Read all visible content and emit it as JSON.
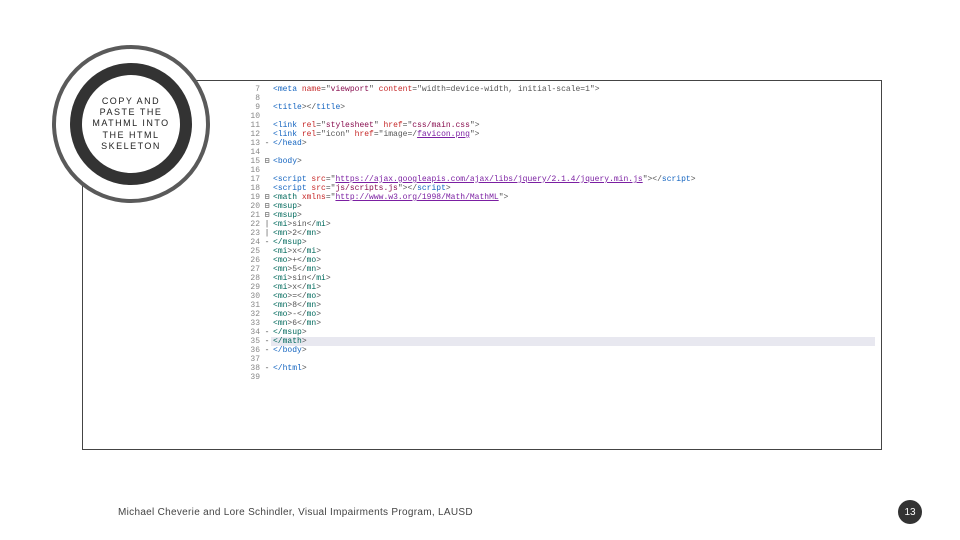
{
  "badge": {
    "title": "COPY AND PASTE THE MATHML INTO THE HTML SKELETON"
  },
  "code": {
    "lines": [
      {
        "n": 7,
        "fold": "",
        "hl": false,
        "segs": [
          {
            "t": "    <",
            "c": "s-blue"
          },
          {
            "t": "meta ",
            "c": "s-blue"
          },
          {
            "t": "name",
            "c": "s-red"
          },
          {
            "t": "=\"",
            "c": ""
          },
          {
            "t": "viewport",
            "c": "s-maroon"
          },
          {
            "t": "\" ",
            "c": ""
          },
          {
            "t": "content",
            "c": "s-red"
          },
          {
            "t": "=\"width=device-width, initial-scale=1\">",
            "c": ""
          }
        ]
      },
      {
        "n": 8,
        "fold": "",
        "hl": false,
        "segs": [
          {
            "t": "",
            "c": ""
          }
        ]
      },
      {
        "n": 9,
        "fold": "",
        "hl": false,
        "segs": [
          {
            "t": "    <",
            "c": "s-blue"
          },
          {
            "t": "title",
            "c": "s-blue"
          },
          {
            "t": "></",
            "c": ""
          },
          {
            "t": "title",
            "c": "s-blue"
          },
          {
            "t": ">",
            "c": ""
          }
        ]
      },
      {
        "n": 10,
        "fold": "",
        "hl": false,
        "segs": [
          {
            "t": "",
            "c": ""
          }
        ]
      },
      {
        "n": 11,
        "fold": "",
        "hl": false,
        "segs": [
          {
            "t": "    <",
            "c": "s-blue"
          },
          {
            "t": "link ",
            "c": "s-blue"
          },
          {
            "t": "rel",
            "c": "s-red"
          },
          {
            "t": "=\"",
            "c": ""
          },
          {
            "t": "stylesheet",
            "c": "s-maroon"
          },
          {
            "t": "\" ",
            "c": ""
          },
          {
            "t": "href",
            "c": "s-red"
          },
          {
            "t": "=\"",
            "c": ""
          },
          {
            "t": "css/main.css",
            "c": "s-maroon"
          },
          {
            "t": "\">",
            "c": ""
          }
        ]
      },
      {
        "n": 12,
        "fold": "",
        "hl": false,
        "segs": [
          {
            "t": "    <",
            "c": "s-blue"
          },
          {
            "t": "link ",
            "c": "s-blue"
          },
          {
            "t": "rel",
            "c": "s-red"
          },
          {
            "t": "=\"icon\" ",
            "c": ""
          },
          {
            "t": "href",
            "c": "s-red"
          },
          {
            "t": "=\"image=/",
            "c": ""
          },
          {
            "t": "favicon.png",
            "c": "s-purple"
          },
          {
            "t": "\">",
            "c": ""
          }
        ]
      },
      {
        "n": 13,
        "fold": "-",
        "hl": false,
        "segs": [
          {
            "t": "</",
            "c": "s-blue"
          },
          {
            "t": "head",
            "c": "s-blue"
          },
          {
            "t": ">",
            "c": ""
          }
        ]
      },
      {
        "n": 14,
        "fold": "",
        "hl": false,
        "segs": [
          {
            "t": "",
            "c": ""
          }
        ]
      },
      {
        "n": 15,
        "fold": "⊟",
        "hl": false,
        "segs": [
          {
            "t": "<",
            "c": "s-blue"
          },
          {
            "t": "body",
            "c": "s-blue"
          },
          {
            "t": ">",
            "c": ""
          }
        ]
      },
      {
        "n": 16,
        "fold": "",
        "hl": false,
        "segs": [
          {
            "t": "",
            "c": ""
          }
        ]
      },
      {
        "n": 17,
        "fold": "",
        "hl": false,
        "segs": [
          {
            "t": "    <",
            "c": "s-blue"
          },
          {
            "t": "script ",
            "c": "s-blue"
          },
          {
            "t": "src",
            "c": "s-red"
          },
          {
            "t": "=\"",
            "c": ""
          },
          {
            "t": "https://ajax.googleapis.com/ajax/libs/jquery/2.1.4/jquery.min.js",
            "c": "s-purple"
          },
          {
            "t": "\"></",
            "c": ""
          },
          {
            "t": "script",
            "c": "s-blue"
          },
          {
            "t": ">",
            "c": ""
          }
        ]
      },
      {
        "n": 18,
        "fold": "",
        "hl": false,
        "segs": [
          {
            "t": "    <",
            "c": "s-blue"
          },
          {
            "t": "script ",
            "c": "s-blue"
          },
          {
            "t": "src",
            "c": "s-red"
          },
          {
            "t": "=\"",
            "c": ""
          },
          {
            "t": "js/scripts.js",
            "c": "s-maroon"
          },
          {
            "t": "\"></",
            "c": ""
          },
          {
            "t": "script",
            "c": "s-blue"
          },
          {
            "t": ">",
            "c": ""
          }
        ]
      },
      {
        "n": 19,
        "fold": "⊟",
        "hl": false,
        "segs": [
          {
            "t": "    <",
            "c": "s-teal"
          },
          {
            "t": "math ",
            "c": "s-teal"
          },
          {
            "t": "xmlns",
            "c": "s-red"
          },
          {
            "t": "=\"",
            "c": ""
          },
          {
            "t": "http://www.w3.org/1998/Math/MathML",
            "c": "s-purple"
          },
          {
            "t": "\">",
            "c": ""
          }
        ]
      },
      {
        "n": 20,
        "fold": "⊟",
        "hl": false,
        "segs": [
          {
            "t": "<",
            "c": "s-teal"
          },
          {
            "t": "msup",
            "c": "s-teal"
          },
          {
            "t": ">",
            "c": ""
          }
        ]
      },
      {
        "n": 21,
        "fold": "⊟",
        "hl": false,
        "segs": [
          {
            "t": "    <",
            "c": "s-teal"
          },
          {
            "t": "msup",
            "c": "s-teal"
          },
          {
            "t": ">",
            "c": ""
          }
        ]
      },
      {
        "n": 22,
        "fold": "|",
        "hl": false,
        "segs": [
          {
            "t": "        <",
            "c": "s-teal"
          },
          {
            "t": "mi",
            "c": "s-teal"
          },
          {
            "t": ">sin</",
            "c": ""
          },
          {
            "t": "mi",
            "c": "s-teal"
          },
          {
            "t": ">",
            "c": ""
          }
        ]
      },
      {
        "n": 23,
        "fold": "|",
        "hl": false,
        "segs": [
          {
            "t": "        <",
            "c": "s-teal"
          },
          {
            "t": "mn",
            "c": "s-teal"
          },
          {
            "t": ">2</",
            "c": ""
          },
          {
            "t": "mn",
            "c": "s-teal"
          },
          {
            "t": ">",
            "c": ""
          }
        ]
      },
      {
        "n": 24,
        "fold": "-",
        "hl": false,
        "segs": [
          {
            "t": "    </",
            "c": "s-teal"
          },
          {
            "t": "msup",
            "c": "s-teal"
          },
          {
            "t": ">",
            "c": ""
          }
        ]
      },
      {
        "n": 25,
        "fold": "",
        "hl": false,
        "segs": [
          {
            "t": "    <",
            "c": "s-teal"
          },
          {
            "t": "mi",
            "c": "s-teal"
          },
          {
            "t": ">x</",
            "c": ""
          },
          {
            "t": "mi",
            "c": "s-teal"
          },
          {
            "t": ">",
            "c": ""
          }
        ]
      },
      {
        "n": 26,
        "fold": "",
        "hl": false,
        "segs": [
          {
            "t": "    <",
            "c": "s-teal"
          },
          {
            "t": "mo",
            "c": "s-teal"
          },
          {
            "t": ">+</",
            "c": ""
          },
          {
            "t": "mo",
            "c": "s-teal"
          },
          {
            "t": ">",
            "c": ""
          }
        ]
      },
      {
        "n": 27,
        "fold": "",
        "hl": false,
        "segs": [
          {
            "t": "    <",
            "c": "s-teal"
          },
          {
            "t": "mn",
            "c": "s-teal"
          },
          {
            "t": ">5</",
            "c": ""
          },
          {
            "t": "mn",
            "c": "s-teal"
          },
          {
            "t": ">",
            "c": ""
          }
        ]
      },
      {
        "n": 28,
        "fold": "",
        "hl": false,
        "segs": [
          {
            "t": "    <",
            "c": "s-teal"
          },
          {
            "t": "mi",
            "c": "s-teal"
          },
          {
            "t": ">sin</",
            "c": ""
          },
          {
            "t": "mi",
            "c": "s-teal"
          },
          {
            "t": ">",
            "c": ""
          }
        ]
      },
      {
        "n": 29,
        "fold": "",
        "hl": false,
        "segs": [
          {
            "t": "    <",
            "c": "s-teal"
          },
          {
            "t": "mi",
            "c": "s-teal"
          },
          {
            "t": ">x</",
            "c": ""
          },
          {
            "t": "mi",
            "c": "s-teal"
          },
          {
            "t": ">",
            "c": ""
          }
        ]
      },
      {
        "n": 30,
        "fold": "",
        "hl": false,
        "segs": [
          {
            "t": "    <",
            "c": "s-teal"
          },
          {
            "t": "mo",
            "c": "s-teal"
          },
          {
            "t": ">=</",
            "c": ""
          },
          {
            "t": "mo",
            "c": "s-teal"
          },
          {
            "t": ">",
            "c": ""
          }
        ]
      },
      {
        "n": 31,
        "fold": "",
        "hl": false,
        "segs": [
          {
            "t": "    <",
            "c": "s-teal"
          },
          {
            "t": "mn",
            "c": "s-teal"
          },
          {
            "t": ">8</",
            "c": ""
          },
          {
            "t": "mn",
            "c": "s-teal"
          },
          {
            "t": ">",
            "c": ""
          }
        ]
      },
      {
        "n": 32,
        "fold": "",
        "hl": false,
        "segs": [
          {
            "t": "    <",
            "c": "s-teal"
          },
          {
            "t": "mo",
            "c": "s-teal"
          },
          {
            "t": ">-</",
            "c": ""
          },
          {
            "t": "mo",
            "c": "s-teal"
          },
          {
            "t": ">",
            "c": ""
          }
        ]
      },
      {
        "n": 33,
        "fold": "",
        "hl": false,
        "segs": [
          {
            "t": "    <",
            "c": "s-teal"
          },
          {
            "t": "mn",
            "c": "s-teal"
          },
          {
            "t": ">6</",
            "c": ""
          },
          {
            "t": "mn",
            "c": "s-teal"
          },
          {
            "t": ">",
            "c": ""
          }
        ]
      },
      {
        "n": 34,
        "fold": "-",
        "hl": false,
        "segs": [
          {
            "t": "</",
            "c": "s-teal"
          },
          {
            "t": "msup",
            "c": "s-teal"
          },
          {
            "t": ">",
            "c": ""
          }
        ]
      },
      {
        "n": 35,
        "fold": "-",
        "hl": true,
        "segs": [
          {
            "t": "</",
            "c": "s-teal"
          },
          {
            "t": "math",
            "c": "s-teal"
          },
          {
            "t": ">",
            "c": ""
          }
        ]
      },
      {
        "n": 36,
        "fold": "-",
        "hl": false,
        "segs": [
          {
            "t": "</",
            "c": "s-blue"
          },
          {
            "t": "body",
            "c": "s-blue"
          },
          {
            "t": ">",
            "c": ""
          }
        ]
      },
      {
        "n": 37,
        "fold": "",
        "hl": false,
        "segs": [
          {
            "t": "",
            "c": ""
          }
        ]
      },
      {
        "n": 38,
        "fold": "-",
        "hl": false,
        "segs": [
          {
            "t": "</",
            "c": "s-blue"
          },
          {
            "t": "html",
            "c": "s-blue"
          },
          {
            "t": ">",
            "c": ""
          }
        ]
      },
      {
        "n": 39,
        "fold": "",
        "hl": false,
        "segs": [
          {
            "t": "",
            "c": ""
          }
        ]
      }
    ]
  },
  "footer": {
    "credit": "Michael Cheverie and Lore Schindler, Visual Impairments Program, LAUSD",
    "page": "13"
  }
}
